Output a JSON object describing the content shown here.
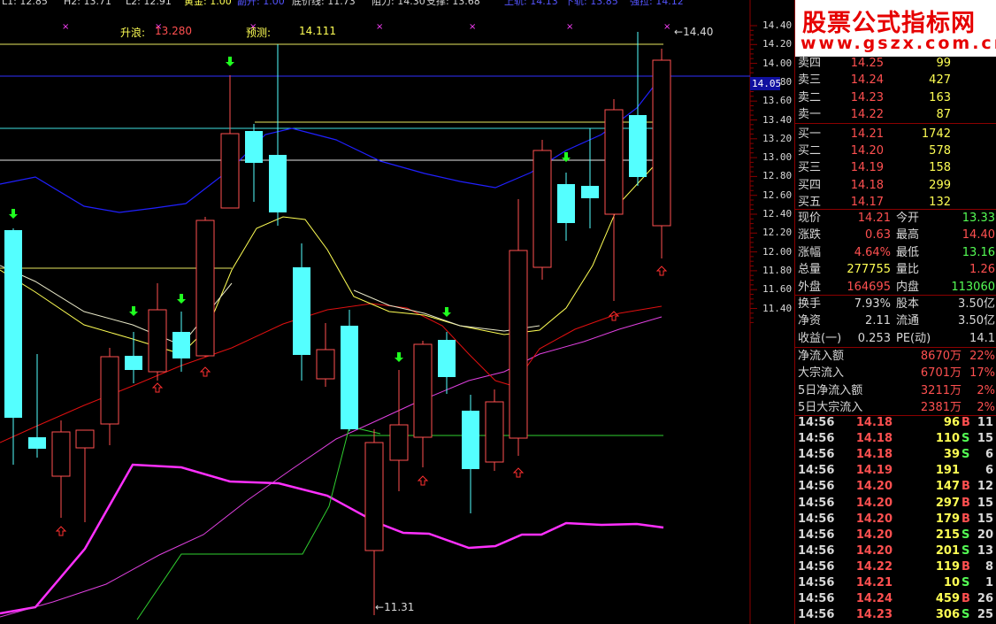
{
  "top_bar": [
    {
      "text": "L1: 12.85",
      "color": "#d8d8d8"
    },
    {
      "text": "H2: 13.71",
      "color": "#d8d8d8"
    },
    {
      "text": "L2: 12.91",
      "color": "#d8d8d8"
    },
    {
      "text": "黄金: 1.00",
      "color": "#ffff54"
    },
    {
      "text": "副升: 1.00",
      "color": "#5454ff"
    },
    {
      "text": "底价线: 11.73",
      "color": "#d8d8d8"
    },
    {
      "text": "阻力: 14.30",
      "color": "#d8d8d8"
    },
    {
      "text": "支撑: 13.68",
      "color": "#d8d8d8"
    },
    {
      "text": "上轨: 14.13",
      "color": "#5454ff"
    },
    {
      "text": "下轨: 13.85",
      "color": "#5454ff"
    },
    {
      "text": "强拉: 14.12",
      "color": "#5454ff"
    }
  ],
  "info": {
    "wave_label": "升浪:",
    "wave_value": "13.280",
    "forecast_label": "预测:",
    "forecast_value": "14.111",
    "high_marker": "14.40",
    "low_marker": "11.31",
    "current_price_tag": "14.05"
  },
  "price_axis": [
    "14.40",
    "14.20",
    "14.00",
    "13.80",
    "13.60",
    "13.40",
    "13.20",
    "13.00",
    "12.80",
    "12.60",
    "12.40",
    "12.20",
    "12.00",
    "11.80",
    "11.60",
    "11.40"
  ],
  "watermark": {
    "title": "股票公式指标网",
    "url": "www.gszx.com.cn"
  },
  "order_book": [
    {
      "label": "卖四",
      "price": "14.25",
      "volume": "99"
    },
    {
      "label": "卖三",
      "price": "14.24",
      "volume": "427"
    },
    {
      "label": "卖二",
      "price": "14.23",
      "volume": "163"
    },
    {
      "label": "卖一",
      "price": "14.22",
      "volume": "87"
    },
    {
      "label": "买一",
      "price": "14.21",
      "volume": "1742"
    },
    {
      "label": "买二",
      "price": "14.20",
      "volume": "578"
    },
    {
      "label": "买三",
      "price": "14.19",
      "volume": "158"
    },
    {
      "label": "买四",
      "price": "14.18",
      "volume": "299"
    },
    {
      "label": "买五",
      "price": "14.17",
      "volume": "132"
    }
  ],
  "quote": [
    {
      "k1": "现价",
      "v1": "14.21",
      "c1": "red",
      "k2": "今开",
      "v2": "13.33",
      "c2": "green"
    },
    {
      "k1": "涨跌",
      "v1": "0.63",
      "c1": "red",
      "k2": "最高",
      "v2": "14.40",
      "c2": "red"
    },
    {
      "k1": "涨幅",
      "v1": "4.64%",
      "c1": "red",
      "k2": "最低",
      "v2": "13.16",
      "c2": "green"
    },
    {
      "k1": "总量",
      "v1": "277755",
      "c1": "yellow",
      "k2": "量比",
      "v2": "1.26",
      "c2": "red"
    },
    {
      "k1": "外盘",
      "v1": "164695",
      "c1": "red",
      "k2": "内盘",
      "v2": "113060",
      "c2": "green"
    }
  ],
  "fundamentals": [
    {
      "k1": "换手",
      "v1": "7.93%",
      "k2": "股本",
      "v2": "3.50亿"
    },
    {
      "k1": "净资",
      "v1": "2.11",
      "k2": "流通",
      "v2": "3.50亿"
    },
    {
      "k1": "收益(一)",
      "v1": "0.253",
      "k2": "PE(动)",
      "v2": "14.1"
    }
  ],
  "flows": [
    {
      "label": "净流入额",
      "value": "8670万",
      "pct": "22%"
    },
    {
      "label": "大宗流入",
      "value": "6701万",
      "pct": "17%"
    },
    {
      "label": "5日净流入额",
      "value": "3211万",
      "pct": "2%"
    },
    {
      "label": "5日大宗流入",
      "value": "2381万",
      "pct": "2%"
    }
  ],
  "trades": [
    {
      "time": "14:56",
      "price": "14.18",
      "vol": "96",
      "side": "B",
      "n": "11"
    },
    {
      "time": "14:56",
      "price": "14.18",
      "vol": "110",
      "side": "S",
      "n": "15"
    },
    {
      "time": "14:56",
      "price": "14.18",
      "vol": "39",
      "side": "S",
      "n": "6"
    },
    {
      "time": "14:56",
      "price": "14.19",
      "vol": "191",
      "side": "",
      "n": "6"
    },
    {
      "time": "14:56",
      "price": "14.20",
      "vol": "147",
      "side": "B",
      "n": "12"
    },
    {
      "time": "14:56",
      "price": "14.20",
      "vol": "297",
      "side": "B",
      "n": "15"
    },
    {
      "time": "14:56",
      "price": "14.20",
      "vol": "179",
      "side": "B",
      "n": "15"
    },
    {
      "time": "14:56",
      "price": "14.20",
      "vol": "215",
      "side": "S",
      "n": "20"
    },
    {
      "time": "14:56",
      "price": "14.20",
      "vol": "201",
      "side": "S",
      "n": "13"
    },
    {
      "time": "14:56",
      "price": "14.22",
      "vol": "119",
      "side": "B",
      "n": "8"
    },
    {
      "time": "14:56",
      "price": "14.21",
      "vol": "10",
      "side": "S",
      "n": "1"
    },
    {
      "time": "14:56",
      "price": "14.24",
      "vol": "459",
      "side": "B",
      "n": "26"
    },
    {
      "time": "14:56",
      "price": "14.23",
      "vol": "306",
      "side": "S",
      "n": "25"
    }
  ],
  "colors": {
    "up": "#ff5050",
    "down": "#54ffff",
    "panel_border": "#8b0000",
    "ma_yellow": "#ffff54",
    "ma_blue": "#2020ff",
    "ma_red": "#e01010",
    "ma_magenta": "#ff40ff",
    "green_line": "#30d030"
  }
}
